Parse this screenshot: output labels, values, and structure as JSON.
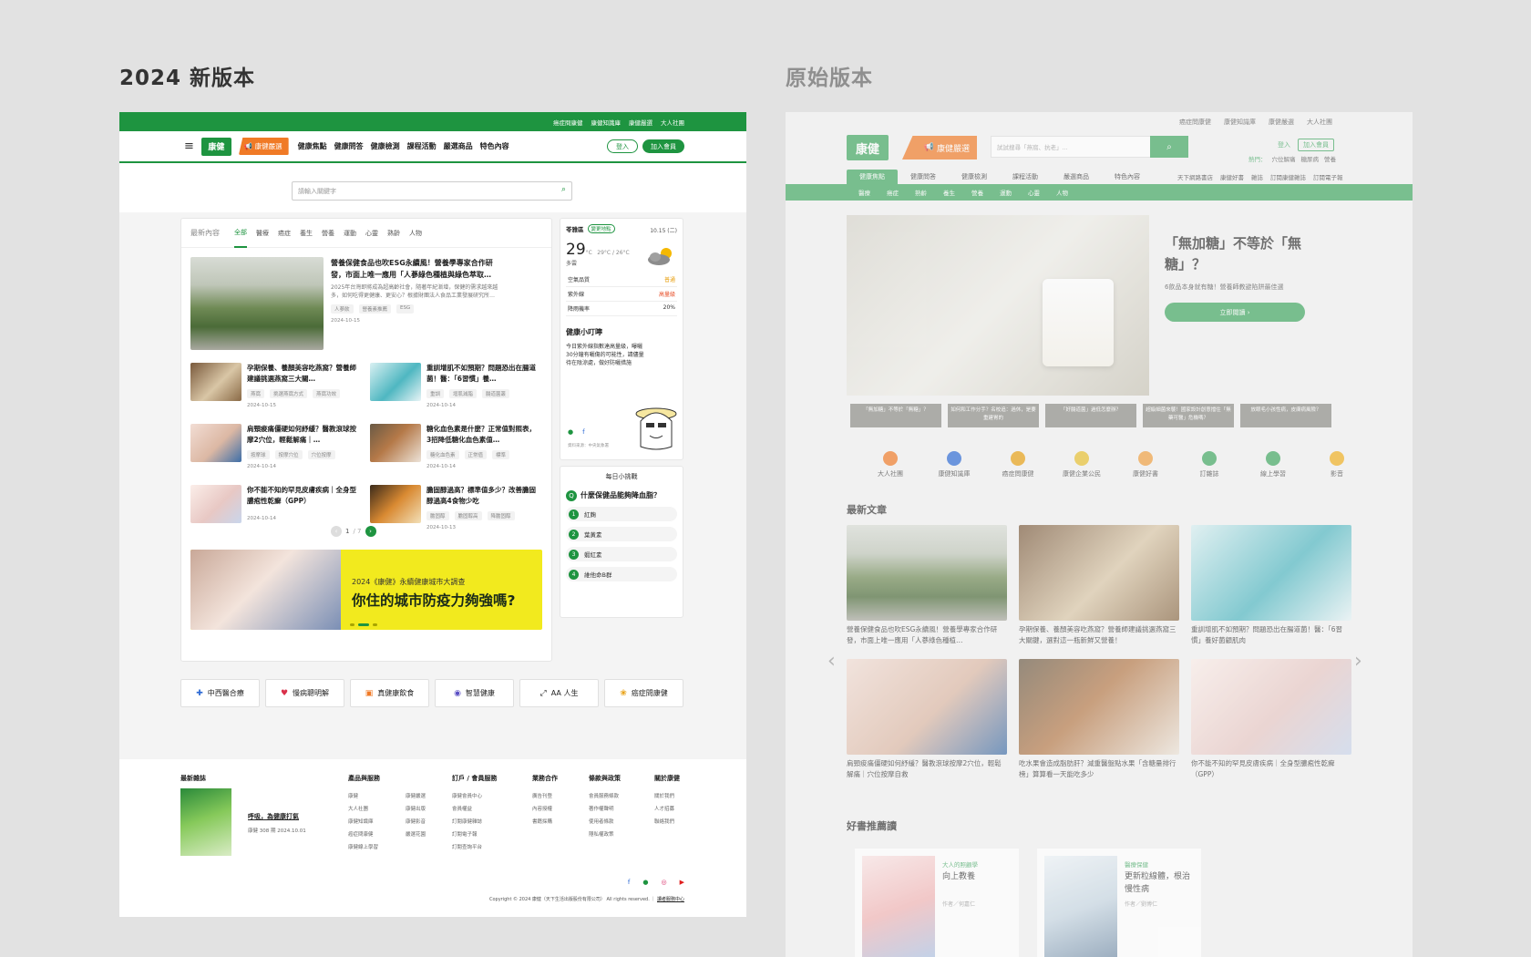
{
  "labels": {
    "new_version": "2024 新版本",
    "old_version": "原始版本"
  },
  "new": {
    "topbar": [
      "癌症問康健",
      "康健知識庫",
      "康健嚴選",
      "大人社團"
    ],
    "logo": "康健",
    "selection": "康健嚴選",
    "nav": [
      "健康焦點",
      "健康問答",
      "健康檢測",
      "課程活動",
      "嚴選商品",
      "特色內容"
    ],
    "login": "登入",
    "join": "加入會員",
    "search_placeholder": "請輸入關鍵字",
    "tabs_label": "最新內容",
    "tabs": [
      "全部",
      "醫療",
      "癌症",
      "養生",
      "營養",
      "運動",
      "心靈",
      "熟齡",
      "人物"
    ],
    "featured": {
      "title": "營養保健食品也吹ESG永續風！營養學專家合作研發，市面上唯一應用「人蔘綠色種植與綠色萃取…",
      "desc": "2025年台灣即將成為超高齡社會，隨著年紀漸增，保健的需求越來越多，如何吃得更健康、更安心？根據財團法人食品工業發展研究所…",
      "tags": [
        "人蔘飲",
        "營養素推薦",
        "ESG"
      ],
      "date": "2024-10-15"
    },
    "articles": [
      {
        "title": "孕期保養、養顏美容吃燕窩？營養師建議挑選燕窩三大關…",
        "tags": [
          "燕窩",
          "挑選燕窩方式",
          "燕窩功效"
        ],
        "date": "2024-10-15"
      },
      {
        "title": "重訓增肌不如預期？問題恐出在腸道菌！醫：「6習慣」養…",
        "tags": [
          "重訓",
          "增肌減脂",
          "腸道菌叢"
        ],
        "date": "2024-10-14"
      },
      {
        "title": "肩頸痠痛僵硬如何紓緩？醫教滾球按摩2穴位，輕鬆解痛｜…",
        "tags": [
          "按摩球",
          "按摩穴位",
          "穴位按摩"
        ],
        "date": "2024-10-14"
      },
      {
        "title": "糖化血色素是什麼？正常值對照表，3招降低糖化血色素值…",
        "tags": [
          "糖化血色素",
          "正常值",
          "標準"
        ],
        "date": "2024-10-14"
      },
      {
        "title": "你不能不知的罕見皮膚疾病｜全身型膿疱性乾癬（GPP）",
        "tags": [],
        "date": "2024-10-14"
      },
      {
        "title": "膽固醇過高？標準值多少？改善膽固醇過高4食物少吃",
        "tags": [
          "膽固醇",
          "膽固醇高",
          "降膽固醇"
        ],
        "date": "2024-10-13"
      }
    ],
    "pager": {
      "current": "1",
      "total": "/ 7"
    },
    "banner": {
      "title": "2024《康健》永續健康城市大調查",
      "main": "你住的城市防疫力夠強嗎?"
    },
    "weather": {
      "city": "苓雅區",
      "change": "變更地點",
      "date": "10.15 (二)",
      "temp": "29",
      "unit": "°C",
      "range": "29°C / 26°C",
      "condition": "多雲",
      "rows": [
        {
          "label": "空氣品質",
          "value": "普通"
        },
        {
          "label": "紫外線",
          "value": "高量級"
        },
        {
          "label": "降雨機率",
          "value": "20%"
        }
      ],
      "tip_title": "健康小叮嚀",
      "tip_text": "今日紫外線指數達高量級，曝曬30分鐘有曬傷的可能性，請儘量待在陰涼處，做好防曬措施",
      "source": "資料來源：中央氣象署"
    },
    "quiz": {
      "head": "每日小挑戰",
      "q": "Q",
      "question": "什麼保健品能夠降血脂？",
      "options": [
        "紅麴",
        "葉黃素",
        "蝦紅素",
        "維他命B群"
      ]
    },
    "quick_links": [
      "中西醫合療",
      "慢病聰明解",
      "真健康飲食",
      "智慧健康",
      "AA 人生",
      "癌症問康健"
    ],
    "footer": {
      "mag_label": "最新雜誌",
      "mag_link": "呼吸，為健康打氣",
      "mag_issue": "康健 308 期 2024.10.01",
      "cols": [
        {
          "title": "產品與服務",
          "items": [
            "康健",
            "大人社團",
            "康健知識庫",
            "癌症問康健",
            "康健線上學習",
            "康健嚴選",
            "康健出版",
            "康健影音",
            "嚴選花園"
          ]
        },
        {
          "title": "訂戶 / 會員服務",
          "items": [
            "康健會員中心",
            "會員權益",
            "訂閱康健雜誌",
            "訂閱電子報",
            "訂閱查詢平台"
          ]
        },
        {
          "title": "業務合作",
          "items": [
            "廣告刊登",
            "內容授權",
            "書籍採購"
          ]
        },
        {
          "title": "條款與政策",
          "items": [
            "會員服務條款",
            "著作權聲明",
            "使用者條款",
            "隱私權政策"
          ]
        },
        {
          "title": "關於康健",
          "items": [
            "關於我們",
            "人才招募",
            "聯絡我們"
          ]
        }
      ],
      "copyright": "Copyright © 2024 康健（天下生活出版股份有限公司） All rights reserved.",
      "help": "讀者服務中心"
    }
  },
  "old": {
    "topbar": [
      "癌症問康健",
      "康健知識庫",
      "康健嚴選",
      "大人社團"
    ],
    "logo": "康健",
    "selection": "康健嚴選",
    "search_placeholder": "試試搜尋「燕窩、抗老」...",
    "login": "登入",
    "join": "加入會員",
    "hot_label": "熱門：",
    "hot": [
      "穴位解痛",
      "糖尿病",
      "營養"
    ],
    "nav": [
      "健康焦點",
      "健康問答",
      "健康檢測",
      "課程活動",
      "嚴選商品",
      "特色內容"
    ],
    "nav2": [
      "天下網路書店",
      "康健好書",
      "雜誌",
      "訂閱康健雜誌",
      "訂閱電子報"
    ],
    "subnav": [
      "醫療",
      "癌症",
      "熟齡",
      "養生",
      "營養",
      "運動",
      "心靈",
      "人物"
    ],
    "hero": {
      "title": "「無加糖」不等於「無糖」？",
      "desc": "6飲品本身就有糖！營養師教避陷阱最佳選",
      "btn": "立即閱讀 ›"
    },
    "thumbs": [
      "「無加糖」不等於「無糖」？",
      "如何和工作分手？名校追：過休，是要重建胃的",
      "「好腸道菌」過低怎麼辦？",
      "超級細菌來襲！國家設計創意擋住「無藥可醫」危機嗎？",
      "放眼毛小孩性病，皮膚病風險？"
    ],
    "icons": [
      "大人社團",
      "康健知識庫",
      "癌症問康健",
      "康健企業公民",
      "康健好書",
      "訂雜誌",
      "線上學習",
      "影音"
    ],
    "latest": "最新文章",
    "grid": [
      "營養保健食品也吹ESG永續風！營養學專家合作研發，市面上唯一應用「人蔘綠色種植…",
      "孕期保養、養顏美容吃燕窩？營養師建議挑選燕窩三大關鍵，選對這一瓶新鮮又營養！",
      "重訓增肌不如預期？問題恐出在腸道菌！醫：「6習慣」養好菌顧肌肉",
      "肩頸痠痛僵硬如何紓緩？醫教滾球按摩2穴位，輕鬆解痛｜穴位按摩自救",
      "吃水果會造成脂肪肝？減重醫盤點水果「含糖量排行榜」算算看一天能吃多少",
      "你不能不知的罕見皮膚疾病｜全身型膿疱性乾癬（GPP）"
    ],
    "books_label": "好書推薦讀",
    "books": [
      {
        "cat": "大人的照顧學",
        "title": "向上教養",
        "author": "作者／何嘉仁"
      },
      {
        "cat": "醫療保健",
        "title": "更新粒線體，根治慢性病",
        "author": "作者／劉博仁"
      }
    ]
  }
}
